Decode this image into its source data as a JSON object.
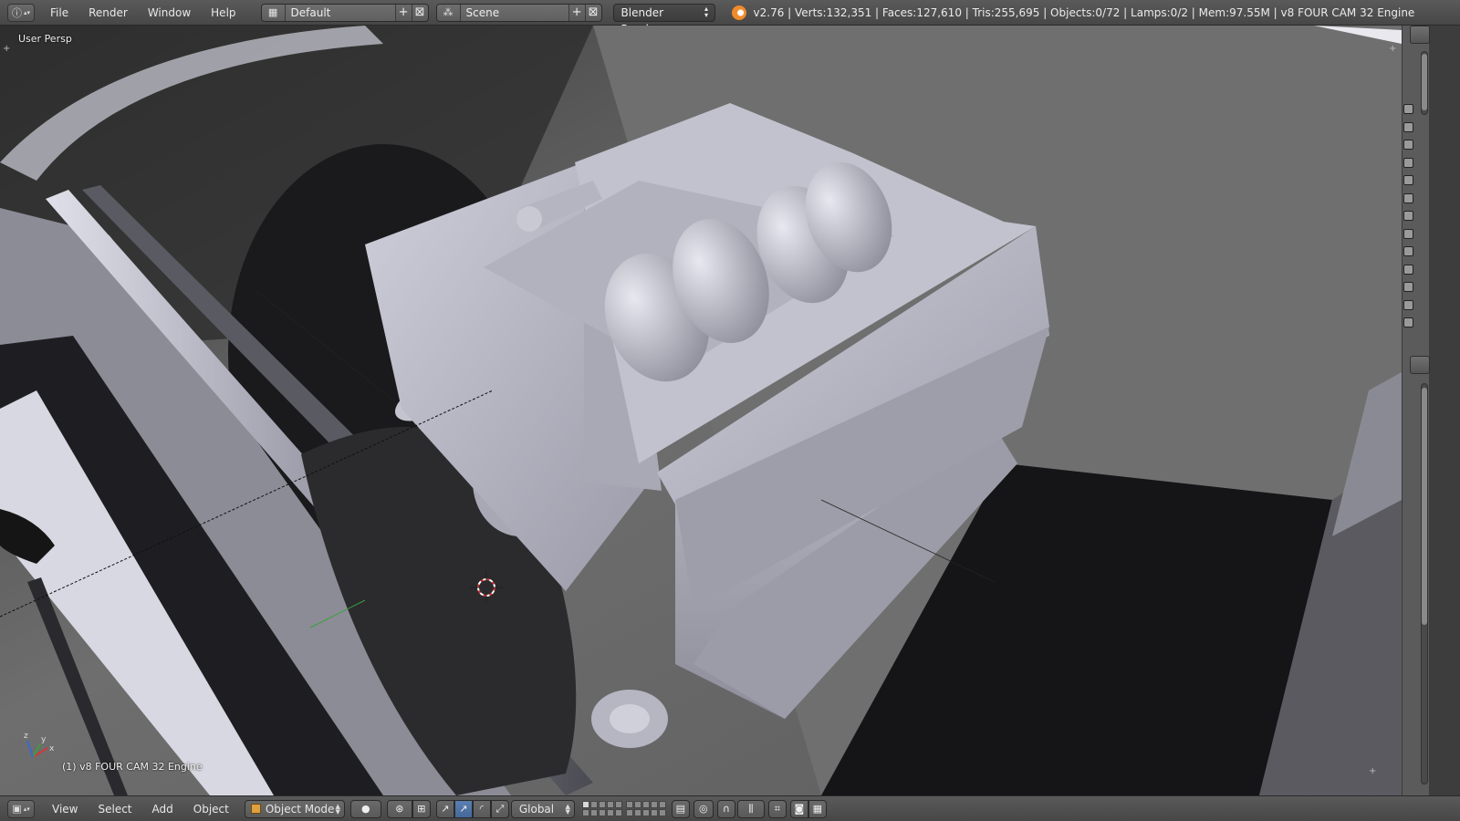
{
  "info_header": {
    "menus": [
      "File",
      "Render",
      "Window",
      "Help"
    ],
    "screen_layout": "Default",
    "scene": "Scene",
    "render_engine": "Blender Render",
    "stats": "v2.76 | Verts:132,351 | Faces:127,610 | Tris:255,695 | Objects:0/72 | Lamps:0/2 | Mem:97.55M | v8 FOUR CAM 32 Engine"
  },
  "viewport": {
    "view_name": "User Persp",
    "active_object": "(1) v8 FOUR CAM 32 Engine",
    "axis_labels": {
      "x": "x",
      "y": "y",
      "z": "z"
    }
  },
  "view3d_header": {
    "menus": [
      "View",
      "Select",
      "Add",
      "Object"
    ],
    "mode": "Object Mode",
    "orientation": "Global"
  },
  "colors": {
    "header_bg": "#4f4f4f",
    "active_blue": "#5a7fb0",
    "engine_body": "#b7b7c6",
    "cursor_red": "#d03030"
  }
}
